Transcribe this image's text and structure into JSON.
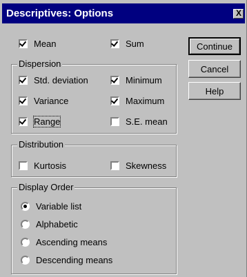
{
  "window": {
    "title": "Descriptives: Options",
    "close_label": "X"
  },
  "top": {
    "mean": {
      "label": "Mean",
      "checked": true
    },
    "sum": {
      "label": "Sum",
      "checked": true
    }
  },
  "dispersion": {
    "legend": "Dispersion",
    "std_deviation": {
      "label": "Std. deviation",
      "checked": true
    },
    "minimum": {
      "label": "Minimum",
      "checked": true
    },
    "variance": {
      "label": "Variance",
      "checked": true
    },
    "maximum": {
      "label": "Maximum",
      "checked": true
    },
    "range": {
      "label": "Range",
      "checked": true
    },
    "se_mean": {
      "label": "S.E. mean",
      "checked": false
    }
  },
  "distribution": {
    "legend": "Distribution",
    "kurtosis": {
      "label": "Kurtosis",
      "checked": false
    },
    "skewness": {
      "label": "Skewness",
      "checked": false
    }
  },
  "display_order": {
    "legend": "Display Order",
    "options": [
      "Variable list",
      "Alphabetic",
      "Ascending means",
      "Descending means"
    ],
    "selected": "Variable list"
  },
  "buttons": {
    "continue": "Continue",
    "cancel": "Cancel",
    "help": "Help"
  }
}
